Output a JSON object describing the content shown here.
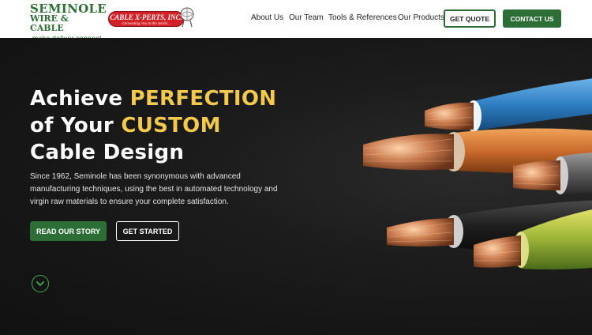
{
  "header": {
    "logo": {
      "line1": "SEMINOLE",
      "line2": "WIRE & CABLE",
      "tagline": "make.deliver.connect."
    },
    "partner_logo": {
      "title": "CABLE X-PERTS, INC.",
      "subtitle": "Connecting You to the World..."
    },
    "nav": [
      {
        "label": "About Us"
      },
      {
        "label": "Our Team"
      },
      {
        "label": "Tools & References"
      },
      {
        "label": "Our Products"
      }
    ],
    "quote_label": "GET QUOTE",
    "contact_label": "CONTACT US"
  },
  "hero": {
    "headline": {
      "l1_pre": "Achieve ",
      "l1_accent": "PERFECTION",
      "l2_pre": "of Your ",
      "l2_accent": "CUSTOM",
      "l3": "Cable Design"
    },
    "description": "Since 1962, Seminole has been synonymous with advanced manufacturing techniques, using the best in automated technology and virgin raw materials to ensure your complete satisfaction.",
    "primary_cta": "READ OUR STORY",
    "secondary_cta": "GET STARTED"
  },
  "colors": {
    "brand_green": "#2c6e35",
    "accent_yellow": "#f2c94c",
    "partner_red": "#d32128"
  },
  "icons": {
    "scroll": "chevron-down-icon"
  }
}
